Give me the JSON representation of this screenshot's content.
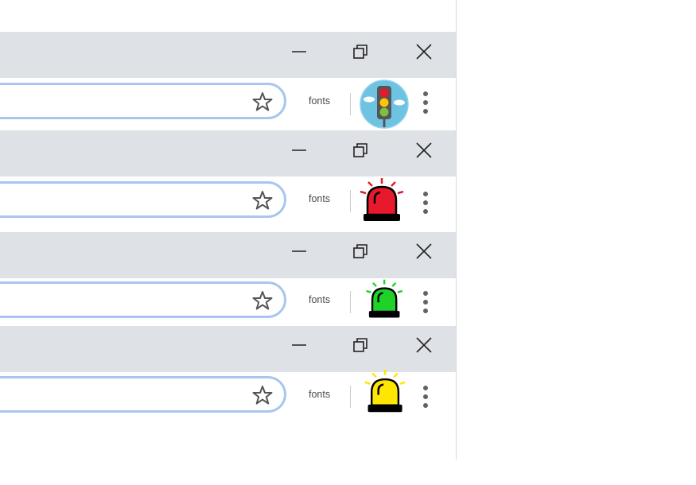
{
  "windows": [
    {
      "extension_label": "fonts",
      "profile_icon": "traffic-light-icon"
    },
    {
      "extension_label": "fonts",
      "profile_icon": "red-siren-icon",
      "siren_color": "#e8192c"
    },
    {
      "extension_label": "fonts",
      "profile_icon": "green-siren-icon",
      "siren_color": "#1fd22a"
    },
    {
      "extension_label": "fonts",
      "profile_icon": "yellow-siren-icon",
      "siren_color": "#ffe600"
    }
  ],
  "colors": {
    "titlebar": "#dee1e6",
    "omnibox_border": "#a8c6ee",
    "traffic_light_bg": "#6ec3e3"
  }
}
